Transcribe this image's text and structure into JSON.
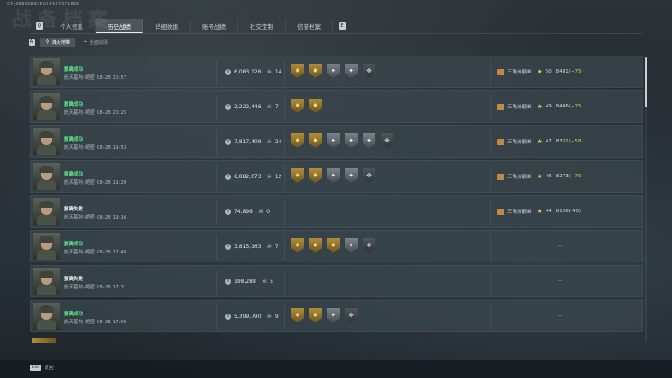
{
  "header": {
    "uid": "CN;9E8988875934587071835",
    "title_watermark": "战备档案"
  },
  "nav": {
    "left_key": "Q",
    "right_key": "E",
    "tabs": [
      {
        "label": "个人信息",
        "active": false
      },
      {
        "label": "历史战绩",
        "active": true
      },
      {
        "label": "详细数据",
        "active": false
      },
      {
        "label": "账号战绩",
        "active": false
      },
      {
        "label": "社交定制",
        "active": false
      },
      {
        "label": "信誉档案",
        "active": false
      }
    ]
  },
  "subnav": {
    "left_key": "A",
    "right_key": "D",
    "tabs": [
      {
        "label": "烽火地带",
        "active": true,
        "icon": "person-icon"
      },
      {
        "label": "全面战场",
        "active": false,
        "icon": "crosshair-icon"
      }
    ]
  },
  "rows": [
    {
      "status": "撤离成功",
      "ok": true,
      "map": "航天基地-绝密 08-28 20:57",
      "money": "6,083,126",
      "kills": "14",
      "badges": [
        "gold",
        "gold",
        "silver",
        "silver",
        "dark"
      ],
      "rank": {
        "mode": "三角洲巅峰",
        "level": "50",
        "points": "8481",
        "delta": "(+75)",
        "up": true
      }
    },
    {
      "status": "撤离成功",
      "ok": true,
      "map": "航天基地-绝密 08-28 20:25",
      "money": "2,222,446",
      "kills": "7",
      "badges": [
        "gold",
        "gold"
      ],
      "rank": {
        "mode": "三角洲巅峰",
        "level": "49",
        "points": "8406",
        "delta": "(+75)",
        "up": true
      }
    },
    {
      "status": "撤离成功",
      "ok": true,
      "map": "航天基地-绝密 08-28 19:53",
      "money": "7,817,409",
      "kills": "24",
      "badges": [
        "gold",
        "gold",
        "silver",
        "silver",
        "silver",
        "dark"
      ],
      "rank": {
        "mode": "三角洲巅峰",
        "level": "47",
        "points": "8331",
        "delta": "(+58)",
        "up": true
      }
    },
    {
      "status": "撤离成功",
      "ok": true,
      "map": "航天基地-绝密 08-28 19:20",
      "money": "6,882,073",
      "kills": "12",
      "badges": [
        "gold",
        "gold",
        "silver",
        "silver",
        "dark"
      ],
      "rank": {
        "mode": "三角洲巅峰",
        "level": "46",
        "points": "8273",
        "delta": "(+75)",
        "up": true
      }
    },
    {
      "status": "撤离失败",
      "ok": false,
      "map": "航天基地-绝密 08-28 19:16",
      "money": "74,898",
      "kills": "0",
      "badges": [],
      "rank": {
        "mode": "三角洲巅峰",
        "level": "44",
        "points": "8198",
        "delta": "(-40)",
        "up": false
      }
    },
    {
      "status": "撤离成功",
      "ok": true,
      "map": "航天基地-绝密 08-28 17:40",
      "money": "3,815,163",
      "kills": "7",
      "badges": [
        "gold",
        "gold",
        "gold",
        "silver",
        "dark"
      ],
      "rank": null
    },
    {
      "status": "撤离失败",
      "ok": false,
      "map": "航天基地-绝密 08-28 17:31",
      "money": "198,288",
      "kills": "5",
      "badges": [],
      "rank": null
    },
    {
      "status": "撤离成功",
      "ok": true,
      "map": "航天基地-绝密 08-28 17:00",
      "money": "5,399,790",
      "kills": "9",
      "badges": [
        "gold",
        "gold",
        "silver",
        "dark"
      ],
      "rank": null
    }
  ],
  "badge_glyphs": {
    "gold": "✹",
    "silver": "✦",
    "dark": "❖"
  },
  "no_rank_text": "--",
  "footer": {
    "key": "Esc",
    "label": "返回"
  }
}
